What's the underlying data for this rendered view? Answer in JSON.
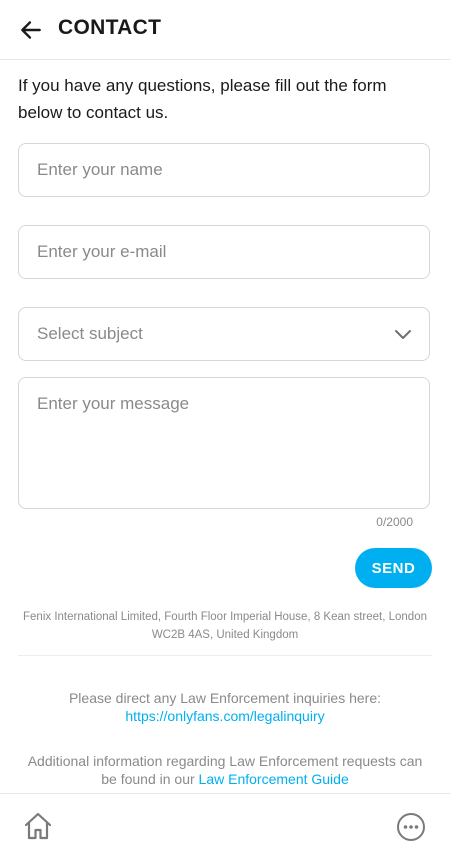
{
  "header": {
    "title": "CONTACT"
  },
  "intro": {
    "text": "If you have any questions, please fill out the form below to contact us."
  },
  "form": {
    "name_placeholder": "Enter your name",
    "email_placeholder": "Enter your e-mail",
    "subject_placeholder": "Select subject",
    "message_placeholder": "Enter your message",
    "counter": "0/2000",
    "send_label": "SEND"
  },
  "footer": {
    "address": "Fenix International Limited, Fourth Floor Imperial House, 8 Kean street, London WC2B 4AS, United Kingdom",
    "law_text": "Please direct any Law Enforcement inquiries here:",
    "law_link": "https://onlyfans.com/legalinquiry",
    "guide_text": "Additional information regarding Law Enforcement requests can be found in our",
    "guide_link": "Law Enforcement Guide"
  },
  "nav": {
    "home_icon": "home-icon",
    "more_icon": "more-icon"
  },
  "colors": {
    "accent": "#00aff0",
    "placeholder": "#8a8a8a"
  }
}
